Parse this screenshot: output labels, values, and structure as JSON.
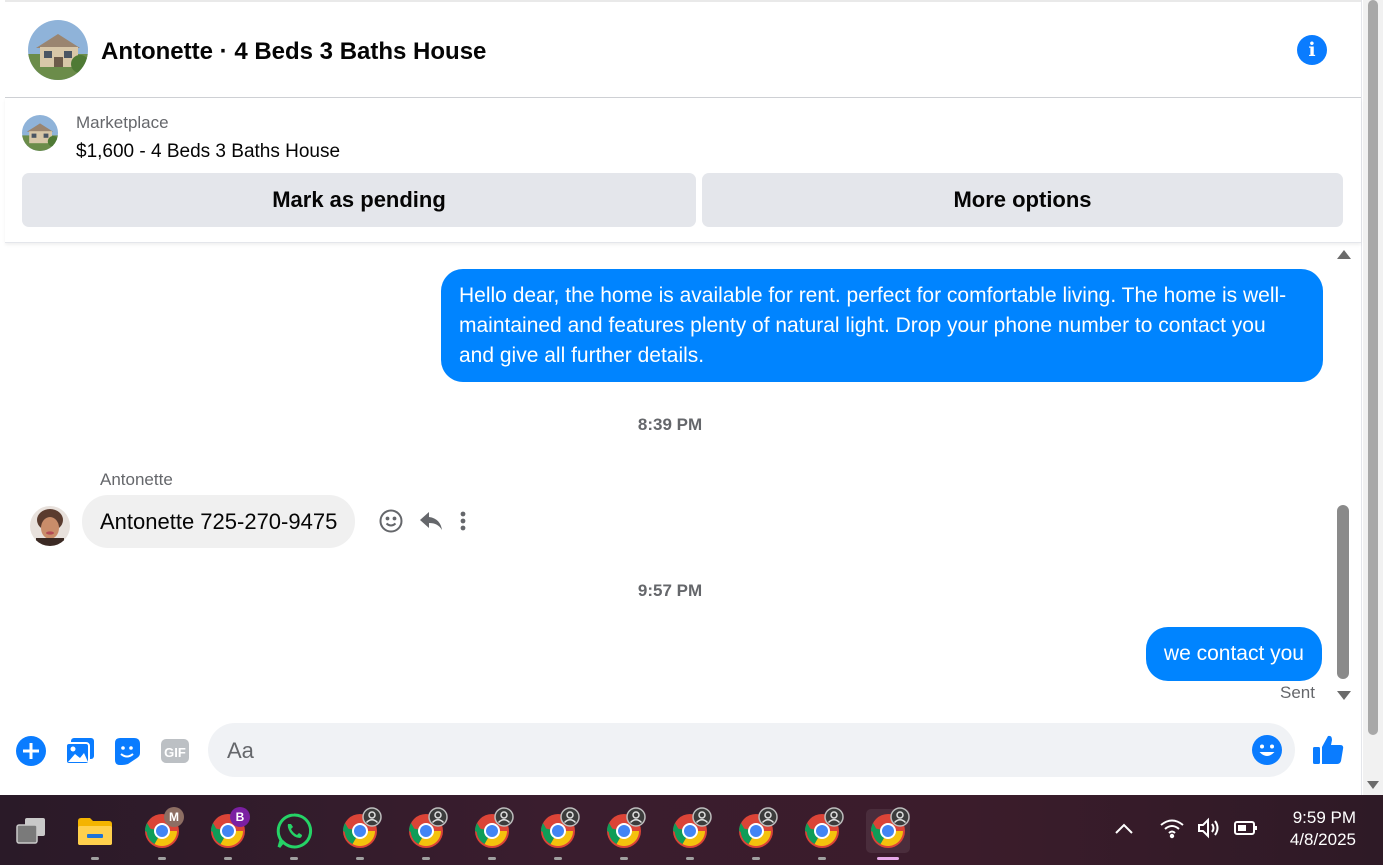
{
  "header": {
    "title": "Antonette · 4 Beds 3 Baths House"
  },
  "marketplace": {
    "label": "Marketplace",
    "listing": "$1,600 - 4 Beds 3 Baths House",
    "mark_pending_label": "Mark as pending",
    "more_options_label": "More options"
  },
  "messages": {
    "outgoing_1": "Hello dear,  the home is available for rent. perfect for comfortable living. The home is well-maintained and features plenty of natural light. Drop your phone number to contact you and give all further details.",
    "timestamp_1": "8:39 PM",
    "sender_name": "Antonette",
    "incoming_1": "Antonette 725-270-9475",
    "timestamp_2": "9:57 PM",
    "outgoing_2": "we contact you",
    "status": "Sent"
  },
  "composer": {
    "placeholder": "Aa",
    "gif_label": "GIF"
  },
  "taskbar": {
    "apps": [
      {
        "name": "file-explorer"
      },
      {
        "name": "chrome",
        "badge": "M",
        "badge_color": "#8d6e63"
      },
      {
        "name": "chrome",
        "badge": "B",
        "badge_color": "#7b1fa2"
      },
      {
        "name": "whatsapp"
      },
      {
        "name": "chrome"
      },
      {
        "name": "chrome"
      },
      {
        "name": "chrome"
      },
      {
        "name": "chrome"
      },
      {
        "name": "chrome"
      },
      {
        "name": "chrome"
      },
      {
        "name": "chrome"
      },
      {
        "name": "chrome"
      },
      {
        "name": "chrome",
        "active": true
      }
    ],
    "time": "9:59 PM",
    "date": "4/8/2025"
  },
  "colors": {
    "accent": "#0084ff",
    "info": "#0a7cff",
    "bubble_in": "#f0f0f0"
  }
}
